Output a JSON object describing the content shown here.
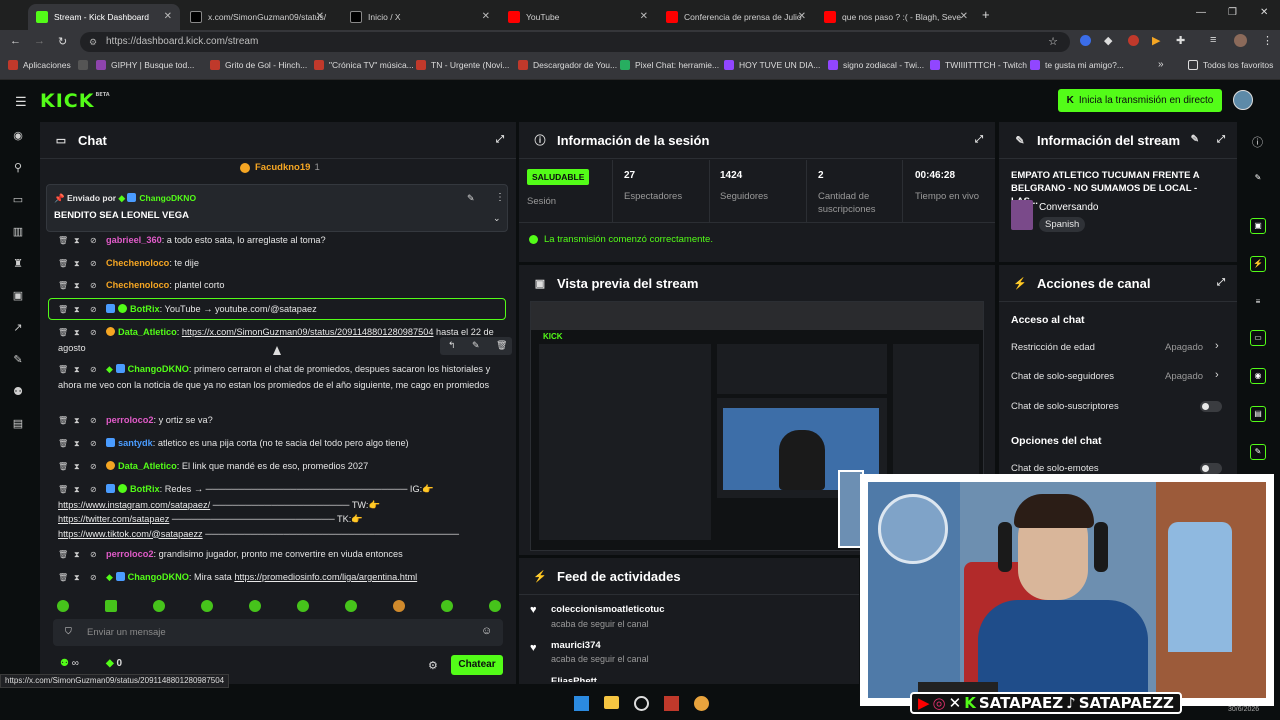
{
  "browser": {
    "tabs": [
      {
        "label": "Stream - Kick Dashboard",
        "active": true,
        "color": "#53fc18"
      },
      {
        "label": "x.com/SimonGuzman09/status/",
        "active": false,
        "color": "#2b2b2b"
      },
      {
        "label": "Inicio / X",
        "active": false,
        "color": "#2b2b2b"
      },
      {
        "label": "YouTube",
        "active": false,
        "color": "#ff0000"
      },
      {
        "label": "Conferencia de prensa de Julio",
        "active": false,
        "color": "#ff0000"
      },
      {
        "label": "que nos paso ? :( - Blagh, Seve",
        "active": false,
        "color": "#ff0000"
      }
    ],
    "url": "https://dashboard.kick.com/stream",
    "bookmarks": [
      "Aplicaciones",
      "GIPHY | Busque tod...",
      "Grito de Gol - Hinch...",
      "\"Crónica TV\" música...",
      "TN - Urgente (Novi...",
      "Descargador de You...",
      "Pixel Chat: herramie...",
      "HOY TUVE UN DIA...",
      "signo zodiacal - Twi...",
      "TWIIIITTTCH - Twitch",
      "te gusta mi amigo?...",
      "Todos los favoritos"
    ]
  },
  "header": {
    "logo": "KICK",
    "beta": "BETA",
    "go_live": "Inicia la transmisión en directo"
  },
  "chat": {
    "title": "Chat",
    "top_user": "Facudkno19",
    "top_count": "1",
    "pinned_by_prefix": "Enviado por",
    "pinned_by_user": "ChangoDKNO",
    "pinned_text": "BENDITO SEA LEONEL VEGA",
    "input_placeholder": "Enviar un mensaje",
    "count": "0",
    "send": "Chatear",
    "status_url": "https://x.com/SimonGuzman09/status/2091148801280987504",
    "messages": [
      {
        "user": "gabrieel_360",
        "text": ": a todo esto sata, lo arreglaste al toma?"
      },
      {
        "user": "Chechenoloco",
        "text": ": te dije"
      },
      {
        "user": "Chechenoloco",
        "text": ": plantel corto"
      },
      {
        "user": "BotRix",
        "text": ": YouTube → youtube.com/@satapaez"
      },
      {
        "user": "Data_Atletico",
        "text": ": ",
        "link": "https://x.com/SimonGuzman09/status/2091148801280987504",
        "after": " hasta el 22 de agosto"
      },
      {
        "user": "ChangoDKNO",
        "text": ": primero cerraron el chat de promiedos, despues sacaron los historiales y ahora me veo con la noticia de que ya no estan los promiedos de el año siguiente, me cago en promiedos"
      },
      {
        "user": "perroloco2",
        "text": ": y ortiz se va?"
      },
      {
        "user": "santydk",
        "text": ": atletico es una pija corta (no te sacia del todo pero algo tiene)"
      },
      {
        "user": "Data_Atletico",
        "text": ": El link que mandé es de eso, promedios 2027"
      },
      {
        "user": "BotRix",
        "text": ": Redes → ─────────────────────────────── IG:👉",
        "l1": "https://www.instagram.com/satapaez/",
        "l1b": "───────────────────── TW:👉",
        "l2": "https://twitter.com/satapaez",
        "l2b": "───────────────────────── TK:👉",
        "l3": "https://www.tiktok.com/@satapaezz",
        "l3b": "───────────────────────────────────────"
      },
      {
        "user": "perroloco2",
        "text": ": grandisimo jugador, pronto me convertire en viuda entonces"
      },
      {
        "user": "ChangoDKNO",
        "text": ": Mira sata ",
        "link": "https://promediosinfo.com/liga/argentina.html"
      }
    ]
  },
  "session": {
    "title": "Información de la sesión",
    "badge": "SALUDABLE",
    "badge_label": "Sesión",
    "stats": [
      {
        "value": "27",
        "label": "Espectadores"
      },
      {
        "value": "1424",
        "label": "Seguidores"
      },
      {
        "value": "2",
        "label": "Cantidad de suscripciones"
      },
      {
        "value": "00:46:28",
        "label": "Tiempo en vivo"
      }
    ],
    "status": "La transmisión comenzó correctamente."
  },
  "preview": {
    "title": "Vista previa del stream"
  },
  "feed": {
    "title": "Feed de actividades",
    "items": [
      {
        "name": "coleccionismoatleticotuc",
        "action": "acaba de seguir el canal"
      },
      {
        "name": "maurici374",
        "action": "acaba de seguir el canal"
      },
      {
        "name": "EliasPhett",
        "action": ""
      }
    ]
  },
  "stream_info": {
    "title": "Información del stream",
    "stream_title": "EMPATO ATLETICO TUCUMAN FRENTE A BELGRANO - NO SUMAMOS DE LOCAL - LAS...",
    "category": "Conversando",
    "language": "Spanish"
  },
  "channel_actions": {
    "title": "Acciones de canal",
    "chat_access": "Acceso al chat",
    "rows": [
      {
        "label": "Restricción de edad",
        "value": "Apagado"
      },
      {
        "label": "Chat de solo-seguidores",
        "value": "Apagado"
      },
      {
        "label": "Chat de solo-suscriptores",
        "value": ""
      }
    ],
    "chat_options": "Opciones del chat",
    "emotes": "Chat de solo-emotes"
  },
  "overlay": {
    "handle1": "SATAPAEZ",
    "handle2": "SATAPAEZZ",
    "date": "30/6/2026"
  },
  "colors": {
    "accent": "#53fc18",
    "bg": "#0b0e0f",
    "panel": "#191b1f"
  }
}
